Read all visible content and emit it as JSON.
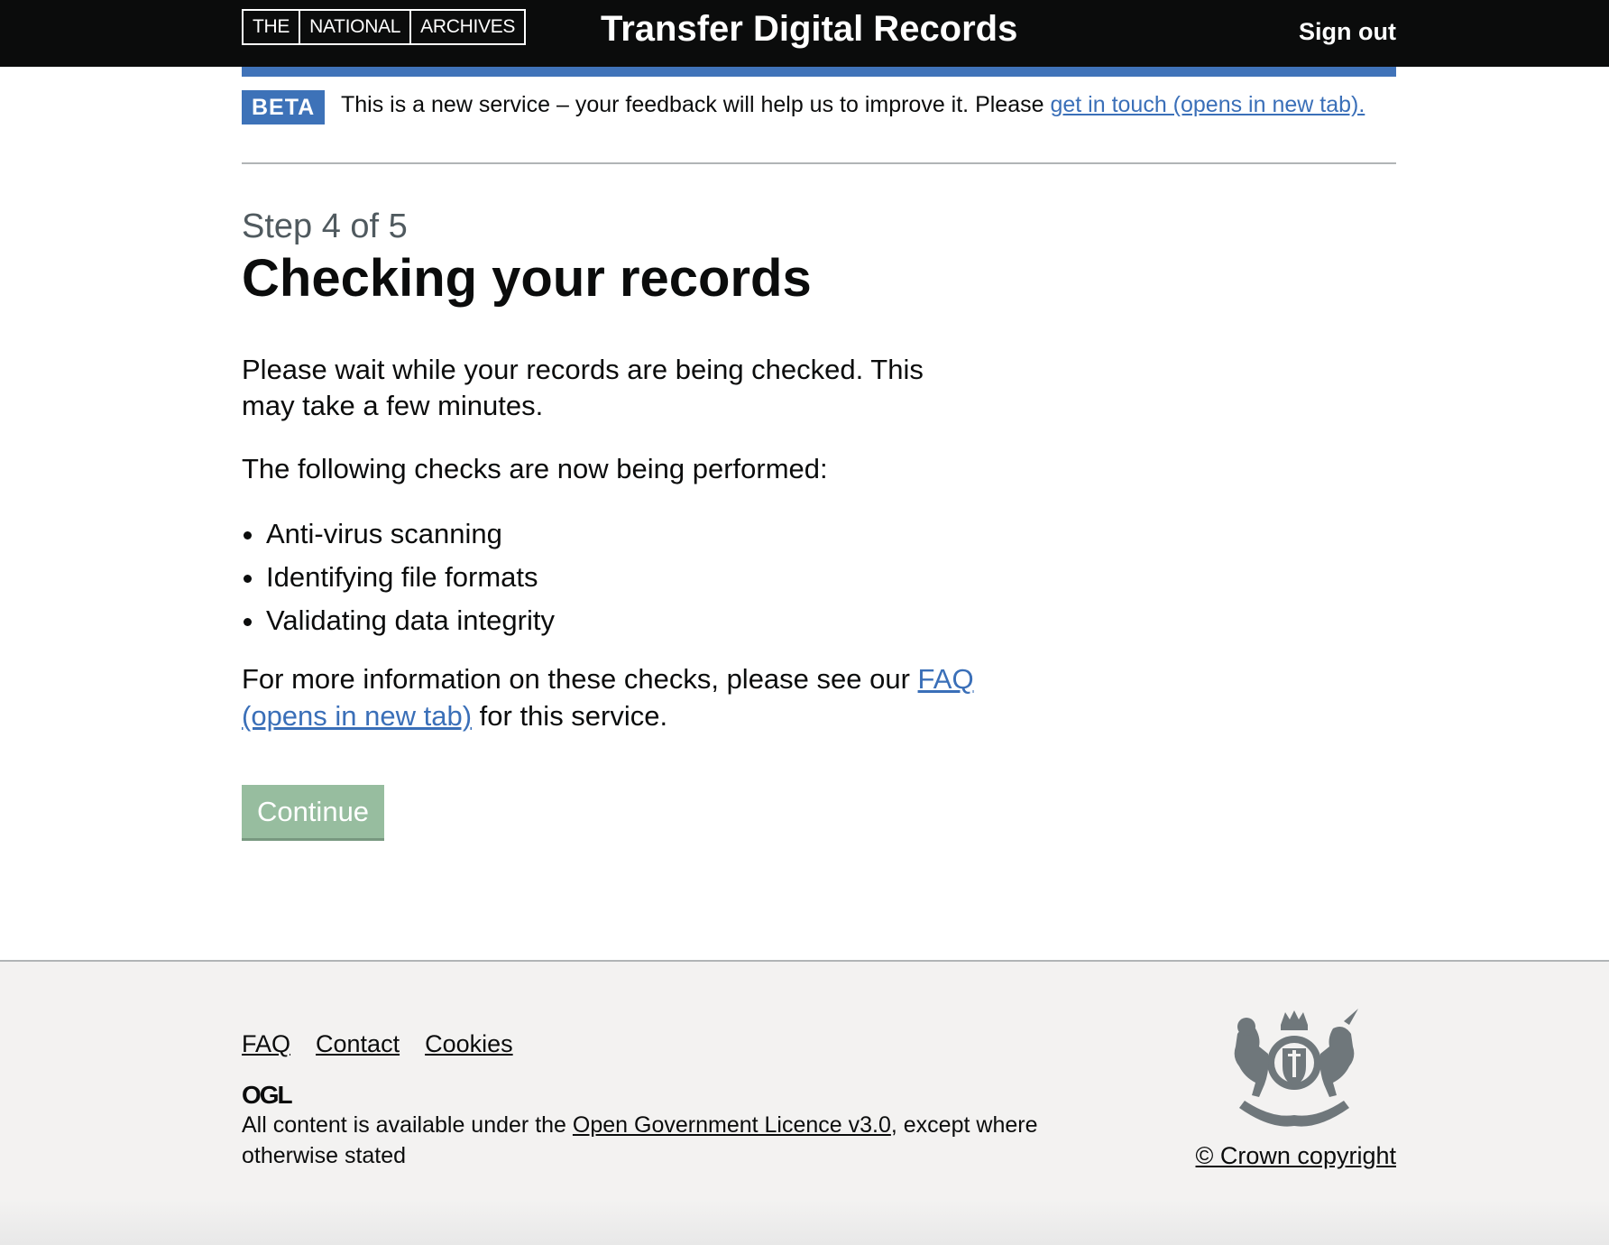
{
  "header": {
    "logo_parts": [
      "THE",
      "NATIONAL",
      "ARCHIVES"
    ],
    "service_name": "Transfer Digital Records",
    "sign_out": "Sign out"
  },
  "phase_banner": {
    "tag": "BETA",
    "text": "This is a new service – your feedback will help us to improve it. Please ",
    "link": "get in touch (opens in new tab)."
  },
  "main": {
    "caption": "Step 4 of 5",
    "title": "Checking your records",
    "intro": "Please wait while your records are being checked. This may take a few minutes.",
    "checks_intro": "The following checks are now being performed:",
    "checks": [
      "Anti-virus scanning",
      "Identifying file formats",
      "Validating data integrity"
    ],
    "more_info_prefix": "For more information on these checks, please see our ",
    "more_info_link": "FAQ (opens in new tab)",
    "more_info_suffix": " for this service.",
    "continue_button": "Continue"
  },
  "footer": {
    "links": [
      "FAQ",
      "Contact",
      "Cookies"
    ],
    "ogl": "OGL",
    "licence_prefix": "All content is available under the ",
    "licence_link": "Open Government Licence v3.0",
    "licence_suffix": ", except where otherwise stated",
    "copyright": "© Crown copyright"
  },
  "colors": {
    "header_bg": "#0b0c0c",
    "accent_blue": "#4073b9",
    "link_blue": "#3a6fb8",
    "button_disabled_green": "#97bd9f",
    "footer_bg": "#f3f2f1"
  }
}
